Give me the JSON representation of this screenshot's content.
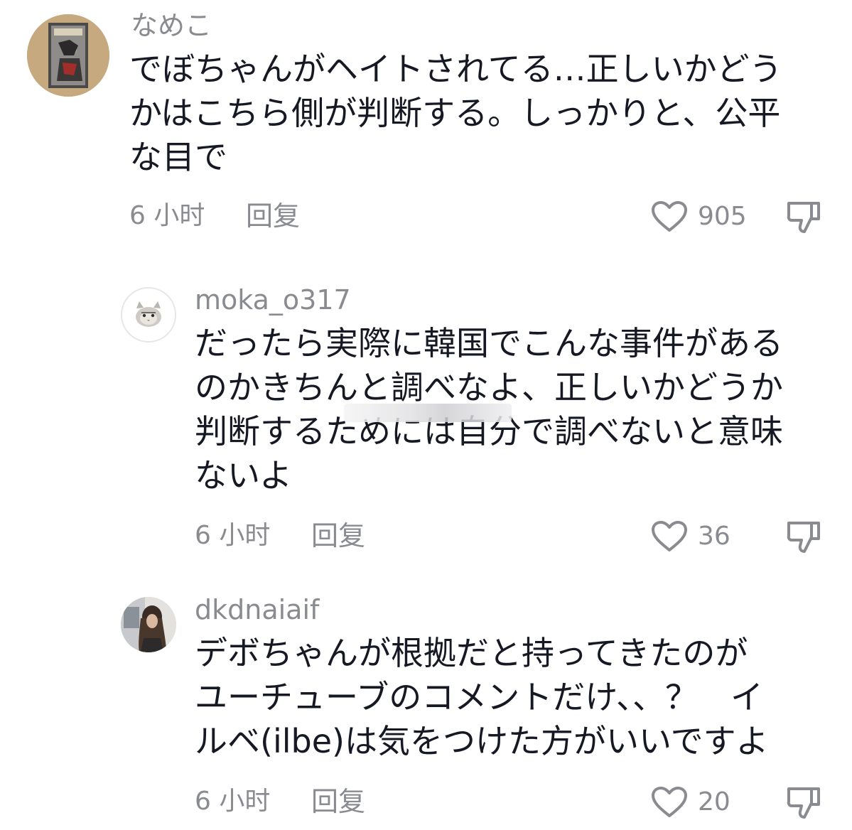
{
  "comments": [
    {
      "username": "なめこ",
      "text_lines": [
        "でぼちゃんがヘイトされてる…正しいかどう",
        "かはこちら側が判断する。しっかりと、公平",
        "な目で"
      ],
      "time": "6 小时",
      "reply_label": "回复",
      "likes": "905"
    },
    {
      "username": "moka_o317",
      "text_lines": [
        "だったら実際に韓国でこんな事件がある",
        "のかきちんと調べなよ、正しいかどうか",
        "判断するためには自分で調べないと意味",
        "ないよ"
      ],
      "time": "6 小时",
      "reply_label": "回复",
      "likes": "36"
    },
    {
      "username": "dkdnaiaif",
      "text_lines": [
        "デボちゃんが根拠だと持ってきたのが",
        "ユーチューブのコメントだけ、、？　イ",
        "ルベ(ilbe)は気をつけた方がいいですよ"
      ],
      "time": "6 小时",
      "reply_label": "回复",
      "likes": "20"
    }
  ],
  "icons": {
    "like": "heart-outline-icon",
    "dislike": "thumbs-down-outline-icon"
  },
  "colors": {
    "text": "#161823",
    "secondary": "#8a8b91"
  }
}
